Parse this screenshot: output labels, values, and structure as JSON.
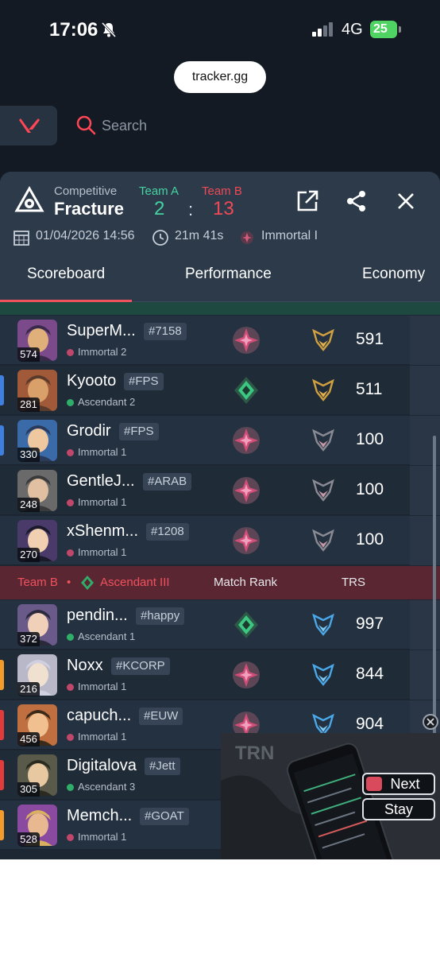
{
  "status_bar": {
    "time": "17:06",
    "network": "4G",
    "battery": "25"
  },
  "browser": {
    "url": "tracker.gg"
  },
  "nav": {
    "search_placeholder": "Search"
  },
  "match": {
    "mode": "Competitive",
    "map": "Fracture",
    "team_a_label": "Team A",
    "team_b_label": "Team B",
    "score_a": "2",
    "score_sep": ":",
    "score_b": "13",
    "date": "01/04/2026 14:56",
    "duration": "21m 41s",
    "avg_rank": "Immortal I"
  },
  "tabs": [
    "Scoreboard",
    "Performance",
    "Economy"
  ],
  "team_b_header": {
    "team": "Team B",
    "bullet": "•",
    "rank": "Ascendant III",
    "col_match_rank": "Match Rank",
    "col_trs": "TRS"
  },
  "team_a_players": [
    {
      "name": "SuperM...",
      "tag": "#7158",
      "rank": "Immortal 2",
      "level": "574",
      "trs": "591",
      "bar": ""
    },
    {
      "name": "Kyooto",
      "tag": "#FPS",
      "rank": "Ascendant 2",
      "level": "281",
      "trs": "511",
      "bar": "#3f7fe0"
    },
    {
      "name": "Grodir",
      "tag": "#FPS",
      "rank": "Immortal 1",
      "level": "330",
      "trs": "100",
      "bar": "#3f7fe0"
    },
    {
      "name": "GentleJ...",
      "tag": "#ARAB",
      "rank": "Immortal 1",
      "level": "248",
      "trs": "100",
      "bar": ""
    },
    {
      "name": "xShenm...",
      "tag": "#1208",
      "rank": "Immortal 1",
      "level": "270",
      "trs": "100",
      "bar": ""
    }
  ],
  "team_b_players": [
    {
      "name": "pendin...",
      "tag": "#happy",
      "rank": "Ascendant 1",
      "level": "372",
      "trs": "997",
      "bar": ""
    },
    {
      "name": "Noxx",
      "tag": "#KCORP",
      "rank": "Immortal 1",
      "level": "216",
      "trs": "844",
      "bar": "#f39b2b"
    },
    {
      "name": "capuch...",
      "tag": "#EUW",
      "rank": "Immortal 1",
      "level": "456",
      "trs": "904",
      "bar": "#e23b3b"
    },
    {
      "name": "Digitalova",
      "tag": "#Jett",
      "rank": "Ascendant 3",
      "level": "305",
      "trs": "",
      "bar": "#e23b3b"
    },
    {
      "name": "Memch...",
      "tag": "#GOAT",
      "rank": "Immortal 1",
      "level": "528",
      "trs": "",
      "bar": "#f39b2b"
    }
  ],
  "ad": {
    "next_label": "Next",
    "stay_label": "Stay",
    "brand": "TRN"
  },
  "colors": {
    "accent": "#f0525d",
    "team_a": "#44d3a1",
    "team_b": "#ee4a56",
    "immortal": "#c0466a",
    "ascendant": "#2fae6a"
  }
}
